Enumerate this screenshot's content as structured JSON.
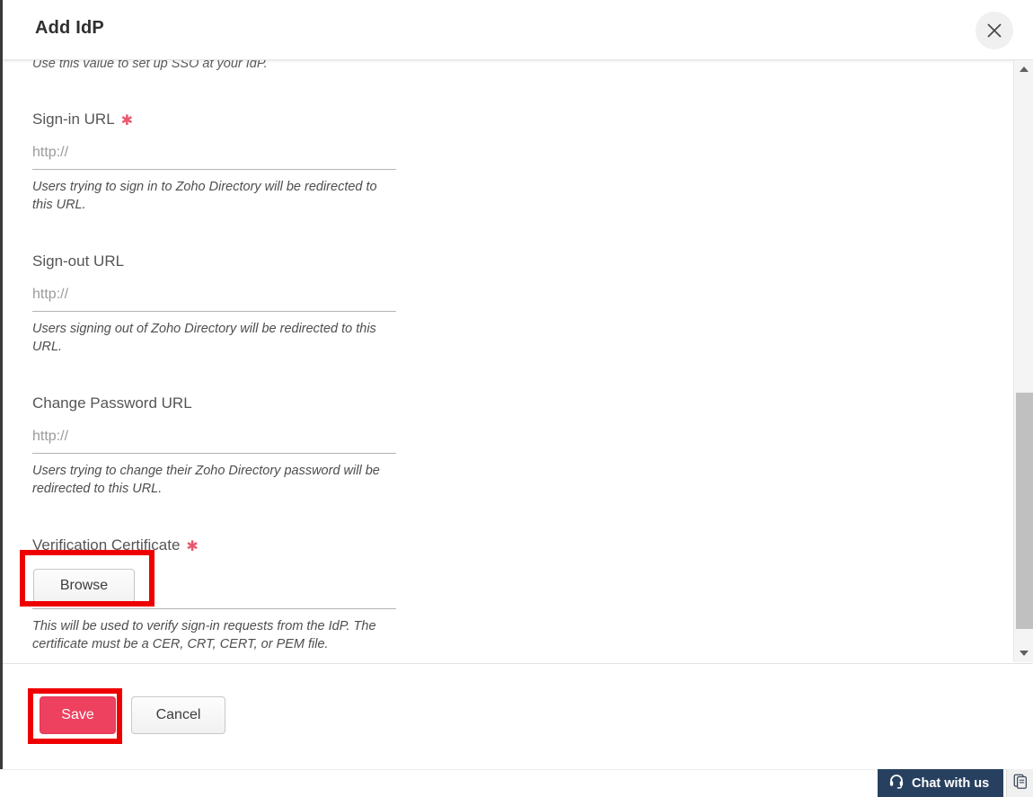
{
  "dialog": {
    "title": "Add IdP",
    "close_icon": "close-icon"
  },
  "body": {
    "truncated_note": "Use this value to set up SSO at your IdP.",
    "fields": [
      {
        "label": "Sign-in URL",
        "required": true,
        "value": "",
        "placeholder": "http://",
        "hint": "Users trying to sign in to Zoho Directory will be redirected to this URL."
      },
      {
        "label": "Sign-out URL",
        "required": false,
        "value": "",
        "placeholder": "http://",
        "hint": "Users signing out of Zoho Directory will be redirected to this URL."
      },
      {
        "label": "Change Password URL",
        "required": false,
        "value": "",
        "placeholder": "http://",
        "hint": "Users trying to change their Zoho Directory password will be redirected to this URL."
      }
    ],
    "certificate": {
      "label": "Verification Certificate",
      "required": true,
      "browse_label": "Browse",
      "hint": "This will be used to verify sign-in requests from the IdP. The certificate must be a CER, CRT, CERT, or PEM file."
    }
  },
  "footer": {
    "save_label": "Save",
    "cancel_label": "Cancel"
  },
  "scrollbar": {
    "up_icon": "chevron-up-icon",
    "down_icon": "chevron-down-icon"
  },
  "chat": {
    "label": "Chat with us",
    "headset_icon": "headset-icon",
    "pages_icon": "copy-pages-icon"
  },
  "highlights": [
    {
      "target": "browse-button"
    },
    {
      "target": "save-button"
    }
  ],
  "colors": {
    "accent_pink": "#ed415f",
    "required_star": "#e8596e",
    "highlight_red": "#ee0000",
    "chat_navy": "#27405f"
  }
}
